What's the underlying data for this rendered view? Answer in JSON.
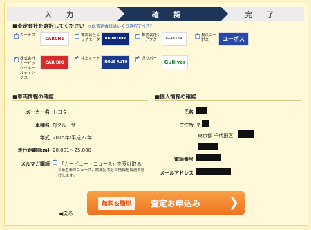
{
  "steps": [
    "入 力",
    "確 認",
    "完 了"
  ],
  "selection": {
    "title": "■査定会社を選択してください",
    "hint": "◎Q.査定会社はいくつ選択すべき？"
  },
  "companies": [
    {
      "name": "カーチス",
      "logo": "CARCHS"
    },
    {
      "name": "株式会社ビッグモーター",
      "logo": "BIGMOTOR"
    },
    {
      "name": "株式会社ジーアフター",
      "logo": "G-AFTER"
    },
    {
      "name": "東京ユーポス",
      "logo": "ユーポス"
    },
    {
      "name": "株式会社カービッグクホールディングス",
      "logo": "CAR BIG"
    },
    {
      "name": "井上オート",
      "logo": "INOUE AUTO"
    },
    {
      "name": "ガリバー",
      "logo": "Gulliver"
    }
  ],
  "vehicle": {
    "section": "■車両情報の確認",
    "fields": [
      {
        "label": "メーカー名",
        "value": "トヨタ"
      },
      {
        "label": "車種名",
        "value": "FJクルーザー"
      },
      {
        "label": "年式",
        "value": "2015年/平成27年"
      },
      {
        "label": "走行距離(km)",
        "value": "20,001～25,000"
      },
      {
        "label": "メルマガ購読",
        "value": "「カービュー・ニュース」を受け取る"
      }
    ],
    "note": "※新型車のニュース、試乗記などの情報を毎週お届けします。"
  },
  "personal": {
    "section": "■個人情報の確認",
    "name_label": "氏名",
    "address_label": "ご住所",
    "postal_prefix": "〒",
    "address_text": "東京都 千代田区",
    "phone_label": "電話番号",
    "email_label": "メールアドレス"
  },
  "submit": {
    "badge": "無料&簡単",
    "label": "査定お申込み"
  },
  "back_label": "◀戻る",
  "colors": {
    "active_step": "#1f3557",
    "submit": "#ef7420"
  }
}
